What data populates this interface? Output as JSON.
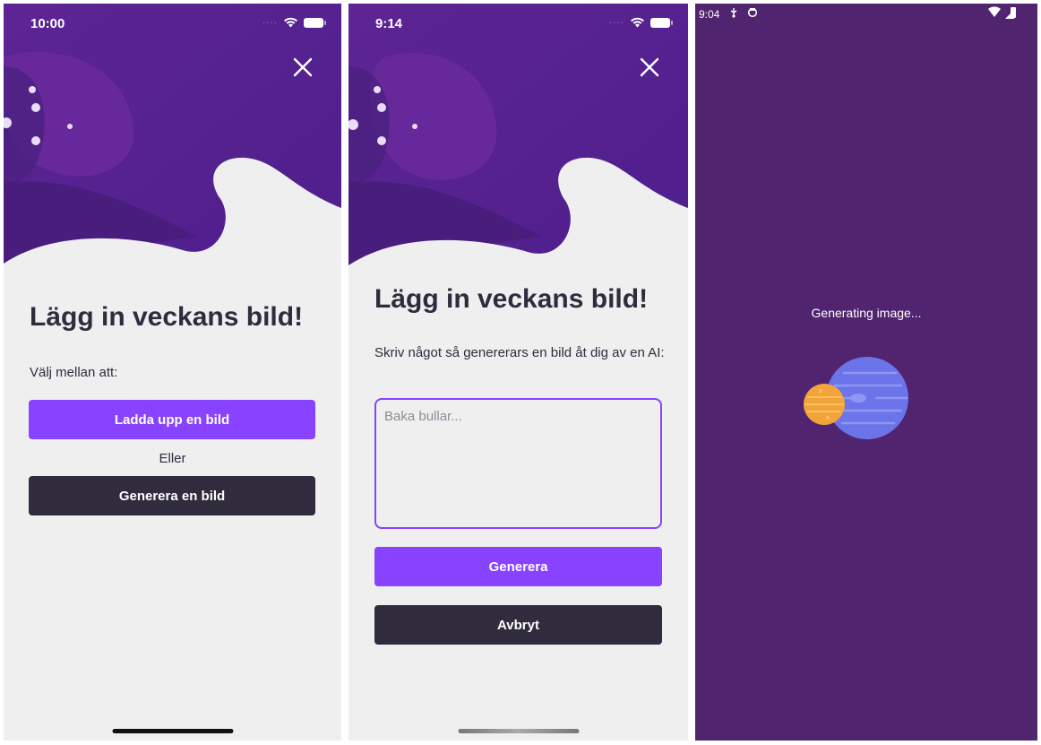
{
  "colors": {
    "background": "#efeff0",
    "hero_purple": "#5a2196",
    "accent": "#8743ff",
    "dark_button": "#302c3e",
    "text": "#2f2c3d",
    "loading_bg": "#50246f"
  },
  "screen1": {
    "status": {
      "time": "10:00"
    },
    "title": "Lägg in veckans bild!",
    "prompt": "Välj mellan att:",
    "upload_button": "Ladda upp en bild",
    "or_text": "Eller",
    "generate_button": "Generera en bild",
    "close_icon": "close-icon"
  },
  "screen2": {
    "status": {
      "time": "9:14"
    },
    "title": "Lägg in veckans bild!",
    "description": "Skriv något så genererars en bild åt dig av en AI:",
    "input": {
      "placeholder": "Baka bullar...",
      "value": ""
    },
    "generate_button": "Generera",
    "cancel_button": "Avbryt",
    "close_icon": "close-icon"
  },
  "screen3": {
    "status": {
      "time": "9:04"
    },
    "loading_text": "Generating image...",
    "illustration": "planets-icon"
  }
}
